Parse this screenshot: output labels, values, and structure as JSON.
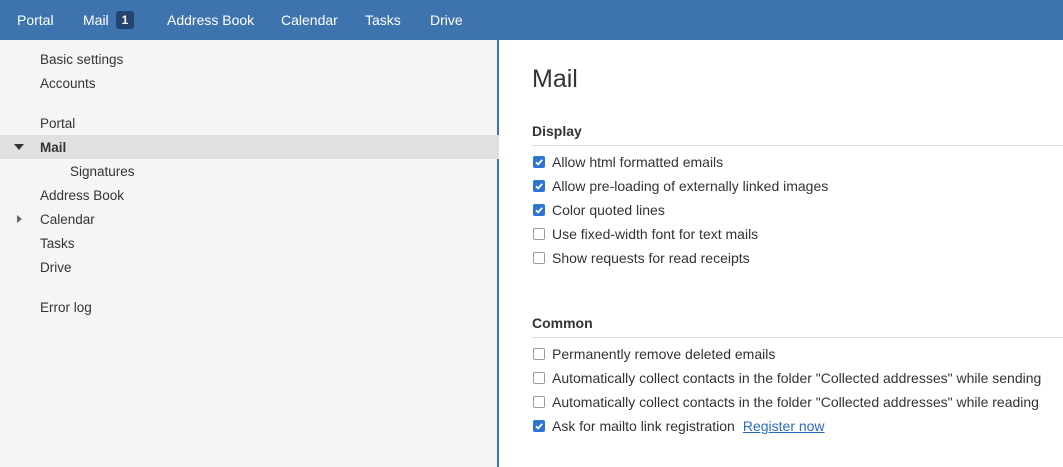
{
  "topbar": {
    "apps": [
      {
        "label": "Portal"
      },
      {
        "label": "Mail",
        "badge": "1"
      },
      {
        "label": "Address Book"
      },
      {
        "label": "Calendar"
      },
      {
        "label": "Tasks"
      },
      {
        "label": "Drive"
      }
    ]
  },
  "sidebar": {
    "items": [
      {
        "label": "Basic settings"
      },
      {
        "label": "Accounts"
      },
      {
        "label": "Portal"
      },
      {
        "label": "Mail",
        "expanded": true,
        "selected": true
      },
      {
        "label": "Signatures"
      },
      {
        "label": "Address Book"
      },
      {
        "label": "Calendar",
        "collapsed": true
      },
      {
        "label": "Tasks"
      },
      {
        "label": "Drive"
      },
      {
        "label": "Error log"
      }
    ]
  },
  "main": {
    "title": "Mail",
    "display": {
      "heading": "Display",
      "options": [
        {
          "label": "Allow html formatted emails",
          "checked": true
        },
        {
          "label": "Allow pre-loading of externally linked images",
          "checked": true
        },
        {
          "label": "Color quoted lines",
          "checked": true
        },
        {
          "label": "Use fixed-width font for text mails",
          "checked": false
        },
        {
          "label": "Show requests for read receipts",
          "checked": false
        }
      ]
    },
    "common": {
      "heading": "Common",
      "options": [
        {
          "label": "Permanently remove deleted emails",
          "checked": false
        },
        {
          "label": "Automatically collect contacts in the folder \"Collected addresses\" while sending",
          "checked": false
        },
        {
          "label": "Automatically collect contacts in the folder \"Collected addresses\" while reading",
          "checked": false
        },
        {
          "label": "Ask for mailto link registration",
          "checked": true
        }
      ],
      "register_link": "Register now"
    }
  },
  "colors": {
    "topbar": "#3d74ad",
    "checkbox": "#2f74d0",
    "link": "#2a6bbf"
  }
}
